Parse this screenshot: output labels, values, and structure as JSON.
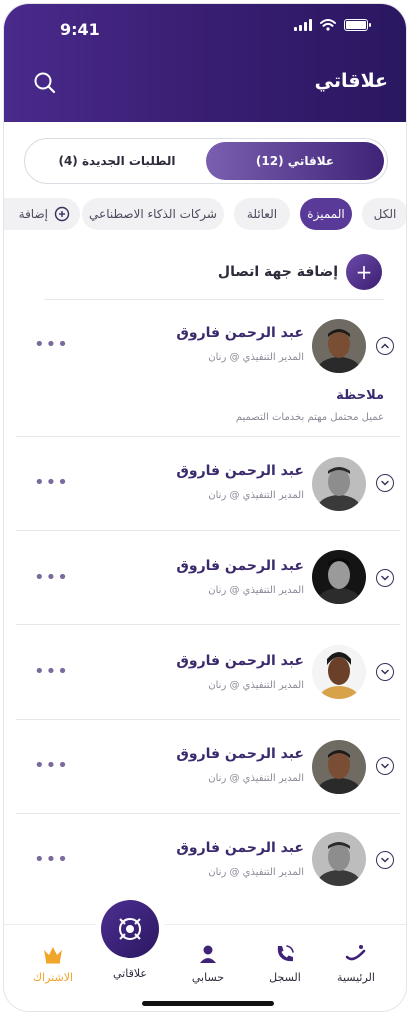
{
  "status_bar": {
    "time": "9:41"
  },
  "header": {
    "title": "علاقاتي"
  },
  "tabs": [
    {
      "label": "علاقاتي (12)",
      "active": true
    },
    {
      "label": "الطلبات الجديدة (4)",
      "active": false
    }
  ],
  "filters": [
    {
      "label": "الكل",
      "active": false
    },
    {
      "label": "المميزة",
      "active": true
    },
    {
      "label": "العائلة",
      "active": false
    },
    {
      "label": "شركات الذكاء الاصطناعي",
      "active": false
    },
    {
      "label": "إضافة",
      "active": false
    }
  ],
  "add_contact": {
    "label": "إضافة جهة اتصال"
  },
  "contacts": [
    {
      "name": "عبد الرحمن فاروق",
      "role": "المدير التنفيذي @ رنان",
      "expanded": true,
      "note_title": "ملاحظة",
      "note_text": "عميل محتمل مهتم بخدمات التصميم"
    },
    {
      "name": "عبد الرحمن فاروق",
      "role": "المدير التنفيذي @ رنان",
      "expanded": false
    },
    {
      "name": "عبد الرحمن فاروق",
      "role": "المدير التنفيذي @ رنان",
      "expanded": false
    },
    {
      "name": "عبد الرحمن فاروق",
      "role": "المدير التنفيذي @ رنان",
      "expanded": false
    },
    {
      "name": "عبد الرحمن فاروق",
      "role": "المدير التنفيذي @ رنان",
      "expanded": false
    },
    {
      "name": "عبد الرحمن فاروق",
      "role": "المدير التنفيذي @ رنان",
      "expanded": false
    }
  ],
  "bottom_nav": {
    "home": "الرئيسية",
    "log": "السجل",
    "account": "حسابي",
    "relations": "علاقاتي",
    "subscription": "الاشتراك"
  },
  "colors": {
    "brand": "#3f2377",
    "accent_gold": "#f0a52b"
  }
}
